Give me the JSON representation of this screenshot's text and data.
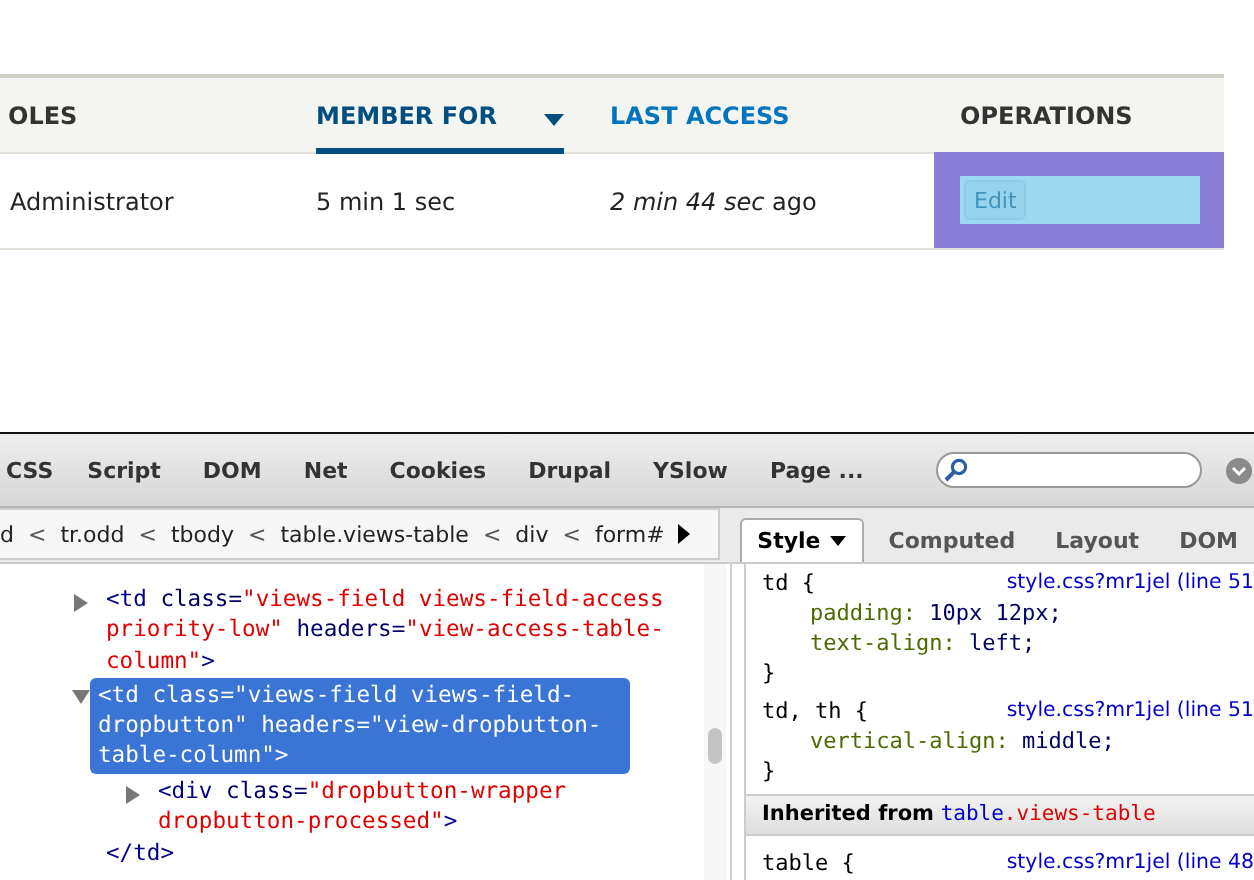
{
  "page_table": {
    "columns": [
      {
        "label": "OLES",
        "kind": "plain",
        "sorted": false
      },
      {
        "label": "MEMBER FOR",
        "kind": "link",
        "sorted": true
      },
      {
        "label": "LAST ACCESS",
        "kind": "link",
        "sorted": false
      },
      {
        "label": "OPERATIONS",
        "kind": "plain",
        "sorted": false
      }
    ],
    "rows": [
      {
        "cells": [
          "Administrator",
          "5 min 1 sec",
          "*2 min 44 sec* ago"
        ],
        "operation": {
          "label": "Edit",
          "highlighted": true
        }
      }
    ]
  },
  "devtools": {
    "tabs": [
      {
        "label": "CSS",
        "selected": false
      },
      {
        "label": "Script",
        "selected": false
      },
      {
        "label": "DOM",
        "selected": false
      },
      {
        "label": "Net",
        "selected": false
      },
      {
        "label": "Cookies",
        "selected": false
      },
      {
        "label": "Drupal",
        "selected": false
      },
      {
        "label": "YSlow",
        "selected": false
      },
      {
        "label": "Page ...",
        "selected": false
      }
    ],
    "breadcrumb": [
      {
        "kind": "item",
        "text": "d"
      },
      {
        "kind": "sep",
        "text": "<"
      },
      {
        "kind": "item",
        "text": "tr.odd"
      },
      {
        "kind": "sep",
        "text": "<"
      },
      {
        "kind": "item",
        "text": "tbody"
      },
      {
        "kind": "sep",
        "text": "<"
      },
      {
        "kind": "item",
        "text": "table.views-table"
      },
      {
        "kind": "sep",
        "text": "<"
      },
      {
        "kind": "item",
        "text": "div"
      },
      {
        "kind": "sep",
        "text": "<"
      },
      {
        "kind": "item",
        "text": "form#"
      }
    ],
    "side_tabs": [
      {
        "label": "Style",
        "selected": true,
        "menu": true
      },
      {
        "label": "Computed",
        "selected": false,
        "menu": false
      },
      {
        "label": "Layout",
        "selected": false,
        "menu": false
      },
      {
        "label": "DOM",
        "selected": false,
        "menu": false
      }
    ],
    "html_tree": [
      {
        "expanded": false,
        "selected": false,
        "lines": [
          [
            {
              "kind": "tag",
              "text": "<td"
            },
            {
              "kind": "attr",
              "text": " class="
            },
            {
              "kind": "value",
              "text": "\"views-field views-field-access"
            }
          ],
          [
            {
              "kind": "value",
              "text": "priority-low\""
            },
            {
              "kind": "attr",
              "text": " headers="
            },
            {
              "kind": "value",
              "text": "\"view-access-table-"
            }
          ],
          [
            {
              "kind": "value",
              "text": "column\""
            },
            {
              "kind": "tag",
              "text": ">"
            }
          ]
        ]
      },
      {
        "expanded": true,
        "selected": true,
        "lines": [
          [
            {
              "kind": "tag",
              "text": "<td"
            },
            {
              "kind": "attr",
              "text": " class="
            },
            {
              "kind": "value",
              "text": "\"views-field views-field-"
            }
          ],
          [
            {
              "kind": "value",
              "text": "dropbutton\""
            },
            {
              "kind": "attr",
              "text": " headers="
            },
            {
              "kind": "value",
              "text": "\"view-dropbutton-"
            }
          ],
          [
            {
              "kind": "value",
              "text": "table-column\""
            },
            {
              "kind": "tag",
              "text": ">"
            }
          ]
        ],
        "children": [
          {
            "expanded": false,
            "selected": false,
            "lines": [
              [
                {
                  "kind": "tag",
                  "text": "<div"
                },
                {
                  "kind": "attr",
                  "text": " class="
                },
                {
                  "kind": "value",
                  "text": "\"dropbutton-wrapper"
                }
              ],
              [
                {
                  "kind": "value",
                  "text": "dropbutton-processed\""
                },
                {
                  "kind": "tag",
                  "text": ">"
                }
              ]
            ]
          }
        ],
        "closing": "</td>"
      }
    ],
    "style_rules": [
      {
        "selector": "td {",
        "source": "style.css?mr1jel (line 51",
        "declarations": [
          {
            "property": "padding:",
            "value": "10px 12px;"
          },
          {
            "property": "text-align:",
            "value": "left;"
          }
        ],
        "close": "}"
      },
      {
        "selector": "td, th {",
        "source": "style.css?mr1jel (line 51",
        "declarations": [
          {
            "property": "vertical-align:",
            "value": "middle;"
          }
        ],
        "close": "}"
      }
    ],
    "inherited": {
      "label": "Inherited from",
      "tag": "table",
      "class_name": ".views-table"
    },
    "inherited_rules": [
      {
        "selector": "table {",
        "source": "style.css?mr1jel (line 48"
      }
    ]
  }
}
